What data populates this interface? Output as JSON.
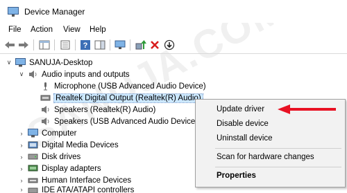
{
  "window": {
    "title": "Device Manager"
  },
  "menu": [
    "File",
    "Action",
    "View",
    "Help"
  ],
  "toolbar_icons": [
    "back-arrow-icon",
    "forward-arrow-icon",
    "show-hide-tree-icon",
    "properties-icon",
    "help-icon",
    "action-pane-icon",
    "scan-hardware-icon",
    "update-driver-icon",
    "uninstall-icon",
    "disable-device-icon"
  ],
  "tree": {
    "root": "SANUJA-Desktop",
    "category_open": "Audio inputs and outputs",
    "devices": [
      "Microphone (USB Advanced Audio Device)",
      "Realtek Digital Output (Realtek(R) Audio)",
      "Speakers (Realtek(R) Audio)",
      "Speakers (USB Advanced Audio Device)"
    ],
    "categories": [
      "Computer",
      "Digital Media Devices",
      "Disk drives",
      "Display adapters",
      "Human Interface Devices",
      "IDE ATA/ATAPI controllers"
    ]
  },
  "context_menu": {
    "items": [
      "Update driver",
      "Disable device",
      "Uninstall device",
      "Scan for hardware changes",
      "Properties"
    ]
  },
  "watermark": "SANUJA.COM",
  "colors": {
    "selection": "#cce8ff",
    "arrow": "#e81123",
    "folder": "#5b8bc9"
  }
}
